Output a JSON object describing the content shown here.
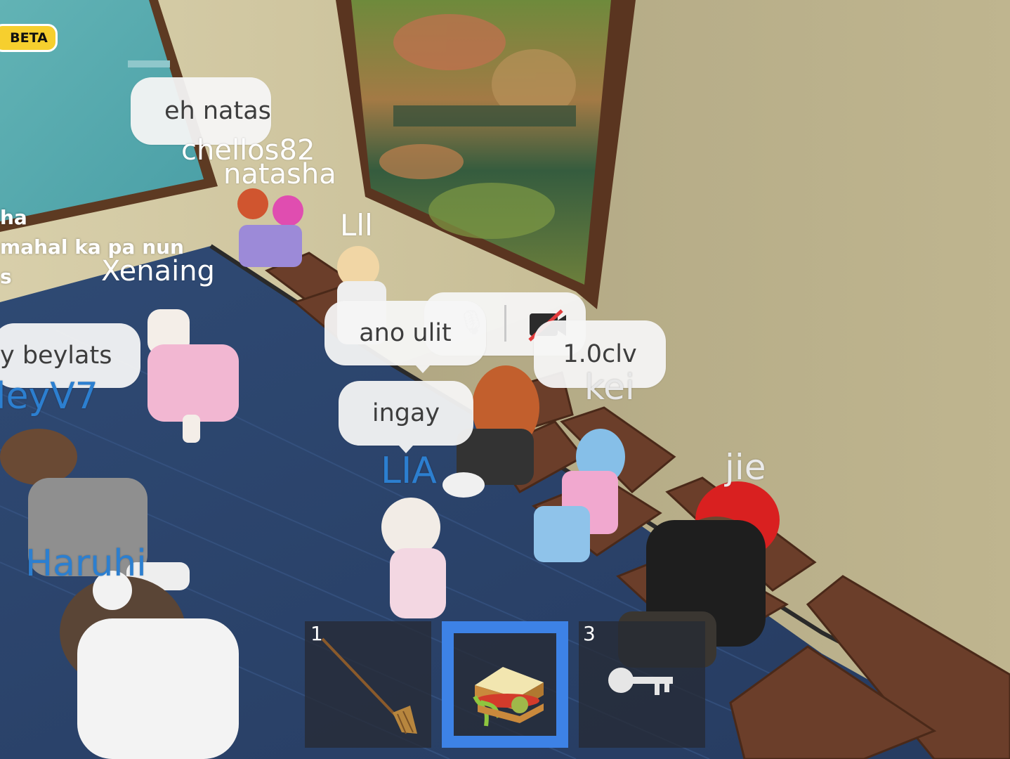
{
  "hud": {
    "beta_badge": "BETA",
    "hotbar": {
      "slots": [
        {
          "number": "1",
          "item": "broom-icon",
          "selected": false
        },
        {
          "number": "",
          "item": "sandwich-icon",
          "selected": true
        },
        {
          "number": "3",
          "item": "key-icon",
          "selected": false
        }
      ]
    },
    "voice_chat": {
      "mic": "microphone-icon",
      "camera": "camera-off-icon"
    },
    "accent_color": "#3d82e6"
  },
  "bubbles": {
    "eh_natas": "eh natas",
    "beylats": "y beylats",
    "ano_ulit": "ano ulit",
    "ingay": "ingay",
    "clv": "1.0clv"
  },
  "names": {
    "chellos": "chellos82",
    "natasha": "natasha",
    "lll": "Lll",
    "xenaing": "Xenaing",
    "leyv7": "leyV7",
    "haruhi": "Haruhi",
    "lia": "LIA",
    "kei": "kei",
    "jie": "jie"
  },
  "side_chat": {
    "line1": "ha",
    "line2": "mahal ka pa nun",
    "line3": "s"
  }
}
